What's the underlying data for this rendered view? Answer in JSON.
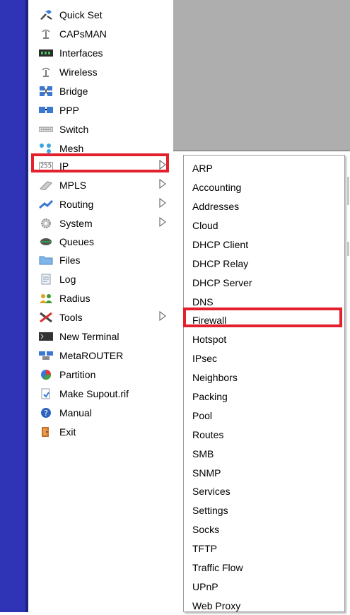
{
  "main_menu": {
    "items": [
      {
        "label": "Quick Set",
        "icon": "quick-set-icon",
        "has_submenu": false
      },
      {
        "label": "CAPsMAN",
        "icon": "capsman-icon",
        "has_submenu": false
      },
      {
        "label": "Interfaces",
        "icon": "interfaces-icon",
        "has_submenu": false
      },
      {
        "label": "Wireless",
        "icon": "wireless-icon",
        "has_submenu": false
      },
      {
        "label": "Bridge",
        "icon": "bridge-icon",
        "has_submenu": false
      },
      {
        "label": "PPP",
        "icon": "ppp-icon",
        "has_submenu": false
      },
      {
        "label": "Switch",
        "icon": "switch-icon",
        "has_submenu": false
      },
      {
        "label": "Mesh",
        "icon": "mesh-icon",
        "has_submenu": false
      },
      {
        "label": "IP",
        "icon": "ip-icon",
        "has_submenu": true
      },
      {
        "label": "MPLS",
        "icon": "mpls-icon",
        "has_submenu": true
      },
      {
        "label": "Routing",
        "icon": "routing-icon",
        "has_submenu": true
      },
      {
        "label": "System",
        "icon": "system-icon",
        "has_submenu": true
      },
      {
        "label": "Queues",
        "icon": "queues-icon",
        "has_submenu": false
      },
      {
        "label": "Files",
        "icon": "files-icon",
        "has_submenu": false
      },
      {
        "label": "Log",
        "icon": "log-icon",
        "has_submenu": false
      },
      {
        "label": "Radius",
        "icon": "radius-icon",
        "has_submenu": false
      },
      {
        "label": "Tools",
        "icon": "tools-icon",
        "has_submenu": true
      },
      {
        "label": "New Terminal",
        "icon": "terminal-icon",
        "has_submenu": false
      },
      {
        "label": "MetaROUTER",
        "icon": "metarouter-icon",
        "has_submenu": false
      },
      {
        "label": "Partition",
        "icon": "partition-icon",
        "has_submenu": false
      },
      {
        "label": "Make Supout.rif",
        "icon": "supout-icon",
        "has_submenu": false
      },
      {
        "label": "Manual",
        "icon": "manual-icon",
        "has_submenu": false
      },
      {
        "label": "Exit",
        "icon": "exit-icon",
        "has_submenu": false
      }
    ],
    "highlighted": "IP",
    "ip_icon_text": "255"
  },
  "ip_submenu": {
    "items": [
      "ARP",
      "Accounting",
      "Addresses",
      "Cloud",
      "DHCP Client",
      "DHCP Relay",
      "DHCP Server",
      "DNS",
      "Firewall",
      "Hotspot",
      "IPsec",
      "Neighbors",
      "Packing",
      "Pool",
      "Routes",
      "SMB",
      "SNMP",
      "Services",
      "Settings",
      "Socks",
      "TFTP",
      "Traffic Flow",
      "UPnP",
      "Web Proxy"
    ],
    "highlighted": "Firewall"
  },
  "colors": {
    "highlight_border": "#e3202b",
    "sidebar_strip": "#2f33b6",
    "background_panel": "#aeaeae"
  }
}
